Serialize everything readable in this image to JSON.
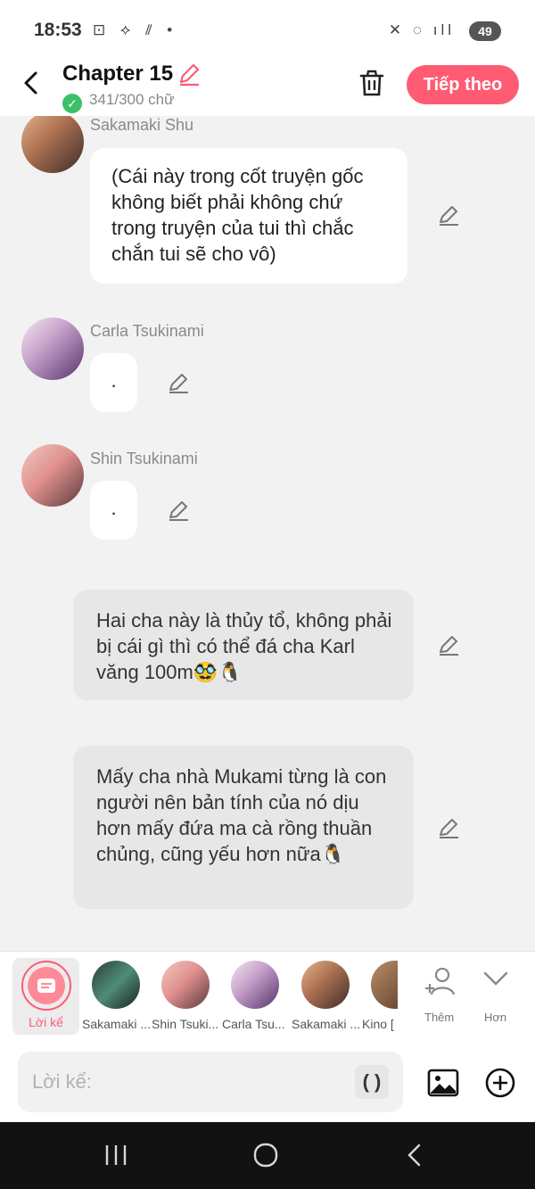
{
  "status_bar": {
    "time": "18:53",
    "battery": "49"
  },
  "header": {
    "title": "Chapter 15",
    "word_count": "341/300 chữ",
    "next_label": "Tiếp theo"
  },
  "messages": [
    {
      "sender": "Sakamaki Shu",
      "text": "(Cái này trong cốt truyện gốc không biết phải không chứ trong truyện của tui thì chắc chắn tui sẽ cho vô)"
    },
    {
      "sender": "Carla Tsukinami",
      "text": "."
    },
    {
      "sender": "Shin Tsukinami",
      "text": "."
    },
    {
      "sender": "",
      "text": "Hai cha này là thủy tổ, không phải bị cái gì thì có thể đá cha Karl văng 100m🥸🐧"
    },
    {
      "sender": "",
      "text": "Mấy cha nhà Mukami từng là con người nên bản tính của nó dịu hơn mấy đứa ma cà rồng thuần chủng, cũng yếu hơn nữa🐧"
    }
  ],
  "character_bar": {
    "narration_label": "Lời kể",
    "characters": [
      "Sakamaki ...",
      "Shin Tsuki...",
      "Carla Tsu...",
      "Sakamaki ...",
      "Kino ["
    ],
    "more_label": "Thêm",
    "collapse_label": "Hơn"
  },
  "input": {
    "placeholder": "Lời kể:",
    "paren_label": "( )"
  },
  "colors": {
    "accent": "#ff5b73",
    "check": "#3cc16a"
  }
}
